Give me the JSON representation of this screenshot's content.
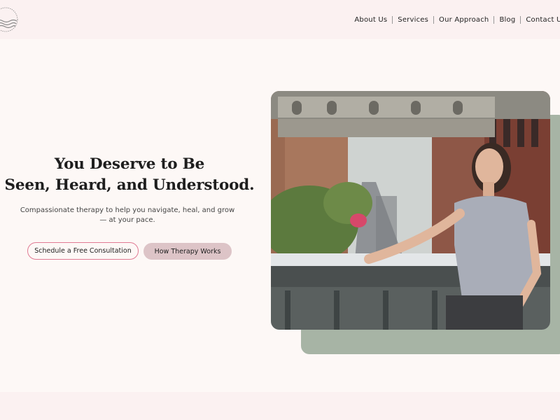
{
  "nav": {
    "items": [
      "About Us",
      "Services",
      "Our Approach",
      "Blog",
      "Contact Us"
    ]
  },
  "hero": {
    "title_line1": "You Deserve to Be",
    "title_line2": "Seen, Heard, and Understood.",
    "subtitle_line1": "Compassionate therapy to help you navigate, heal, and grow",
    "subtitle_line2": "— at your pace.",
    "primary_button": "Schedule a Free Consultation",
    "secondary_button": "How Therapy Works"
  },
  "colors": {
    "header_bg": "#fbf1f1",
    "page_bg": "#fdf8f6",
    "accent_pink": "#e07a93",
    "button_mauve": "#ddc4c7",
    "sage": "#a7b4a5"
  },
  "icons": {
    "logo": "wave-sun-logo"
  }
}
